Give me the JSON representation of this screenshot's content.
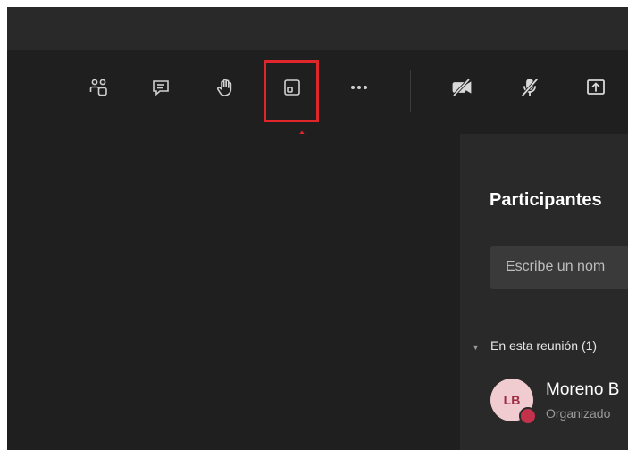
{
  "toolbar": {
    "icons": [
      "people-icon",
      "chat-icon",
      "raise-hand-icon",
      "rooms-icon",
      "more-icon",
      "camera-off-icon",
      "mic-off-icon",
      "share-icon"
    ],
    "accent": "#7f85f5",
    "highlight_color": "#e0262a"
  },
  "panel": {
    "title": "Participantes",
    "search_placeholder": "Escribe un nom",
    "section_label": "En esta reunión (1)",
    "participant": {
      "initials": "LB",
      "name": "Moreno B",
      "role": "Organizado",
      "status_color": "#c4314b"
    }
  }
}
